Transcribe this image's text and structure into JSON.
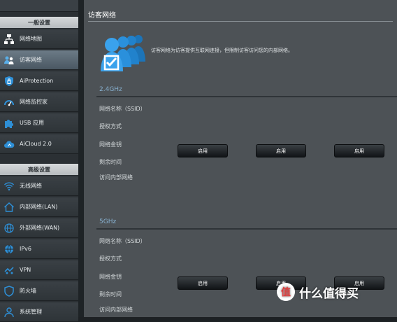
{
  "sidebar": {
    "general_header": "一般设置",
    "advanced_header": "高级设置",
    "general_items": [
      {
        "label": "网络地图",
        "icon": "network-map-icon"
      },
      {
        "label": "访客网络",
        "icon": "guest-network-icon",
        "active": true
      },
      {
        "label": "AiProtection",
        "icon": "aiprotection-icon"
      },
      {
        "label": "网络监控家",
        "icon": "traffic-monitor-icon"
      },
      {
        "label": "USB 应用",
        "icon": "usb-puzzle-icon"
      },
      {
        "label": "AiCloud 2.0",
        "icon": "cloud-icon"
      }
    ],
    "advanced_items": [
      {
        "label": "无线网络",
        "icon": "wifi-icon"
      },
      {
        "label": "内部网络(LAN)",
        "icon": "home-icon"
      },
      {
        "label": "外部网络(WAN)",
        "icon": "globe-icon"
      },
      {
        "label": "IPv6",
        "icon": "ipv6-globe-icon"
      },
      {
        "label": "VPN",
        "icon": "vpn-icon"
      },
      {
        "label": "防火墙",
        "icon": "shield-icon"
      },
      {
        "label": "系统管理",
        "icon": "admin-user-icon"
      }
    ]
  },
  "main": {
    "title": "访客网络",
    "description": "访客网络为访客提供互联网连接，但限制访客访问您的内部网络。",
    "bands": [
      {
        "label": "2.4GHz",
        "rows": [
          "网络名称（SSID）",
          "授权方式",
          "网络金钥",
          "剩余时间",
          "访问内部网络"
        ],
        "buttons": [
          "启用",
          "启用",
          "启用"
        ]
      },
      {
        "label": "5GHz",
        "rows": [
          "网络名称（SSID）",
          "授权方式",
          "网络金钥",
          "剩余时间",
          "访问内部网络"
        ],
        "buttons": [
          "启用",
          "启用",
          "启用"
        ]
      }
    ]
  },
  "watermark": {
    "text": "什么值得买",
    "logo": "值"
  },
  "colors": {
    "accent_blue": "#2e8fd6",
    "band_label": "#87b0cf",
    "active_item": "#5f6e7a"
  }
}
